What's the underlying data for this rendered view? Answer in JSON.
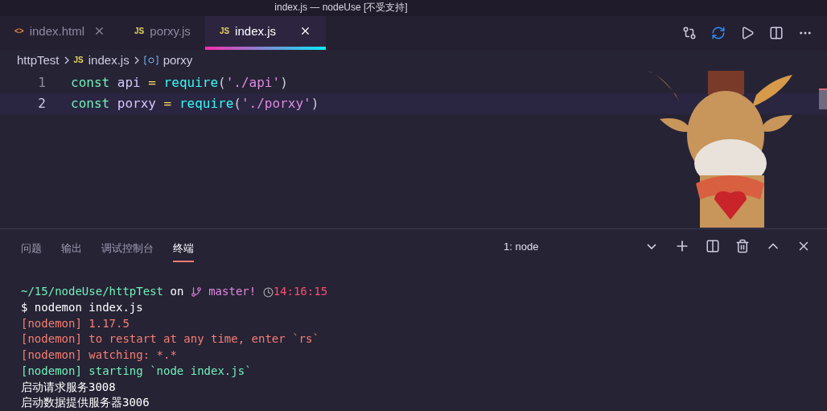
{
  "window": {
    "title": "index.js — nodeUse [不受支持]"
  },
  "tabs": [
    {
      "label": "index.html",
      "kind": "html",
      "badge": "<>",
      "selected": false,
      "closable": true
    },
    {
      "label": "porxy.js",
      "kind": "js",
      "badge": "JS",
      "selected": false,
      "closable": false
    },
    {
      "label": "index.js",
      "kind": "js",
      "badge": "JS",
      "selected": true,
      "closable": true
    }
  ],
  "breadcrumb": [
    {
      "label": "httpTest",
      "kind": "folder"
    },
    {
      "label": "index.js",
      "kind": "js",
      "badge": "JS"
    },
    {
      "label": "porxy",
      "kind": "symbol"
    }
  ],
  "editor": {
    "lines": [
      {
        "number": "1",
        "selected": false,
        "tokens": [
          {
            "kind": "keyword",
            "text": "const "
          },
          {
            "kind": "variable",
            "text": "api"
          },
          {
            "kind": "operator",
            "text": " = "
          },
          {
            "kind": "function",
            "text": "require"
          },
          {
            "kind": "paren",
            "text": "("
          },
          {
            "kind": "string",
            "text": "'./api'"
          },
          {
            "kind": "paren",
            "text": ")"
          }
        ]
      },
      {
        "number": "2",
        "selected": true,
        "tokens": [
          {
            "kind": "keyword",
            "text": "const "
          },
          {
            "kind": "variable",
            "text": "porxy"
          },
          {
            "kind": "operator",
            "text": " = "
          },
          {
            "kind": "function",
            "text": "require"
          },
          {
            "kind": "paren",
            "text": "("
          },
          {
            "kind": "string",
            "text": "'./porxy'"
          },
          {
            "kind": "paren",
            "text": ")"
          }
        ]
      }
    ]
  },
  "panel": {
    "tabs": [
      {
        "label": "问题",
        "selected": false
      },
      {
        "label": "输出",
        "selected": false
      },
      {
        "label": "调试控制台",
        "selected": false
      },
      {
        "label": "终端",
        "selected": true
      }
    ],
    "terminal_select": "1: node"
  },
  "terminal": {
    "prompt": {
      "path": "~/15/nodeUse/httpTest",
      "on": "on",
      "branch": "master!",
      "time": "14:16:15"
    },
    "lines": [
      {
        "kind": "command",
        "text": "$ nodemon index.js"
      },
      {
        "kind": "info",
        "text": "[nodemon] 1.17.5"
      },
      {
        "kind": "info",
        "text": "[nodemon] to restart at any time, enter `rs`"
      },
      {
        "kind": "info",
        "text": "[nodemon] watching: *.*"
      },
      {
        "kind": "success",
        "text": "[nodemon] starting `node index.js`"
      },
      {
        "kind": "output",
        "text": "启动请求服务3008"
      },
      {
        "kind": "output",
        "text": "启动数据提供服务器3006"
      }
    ]
  }
}
